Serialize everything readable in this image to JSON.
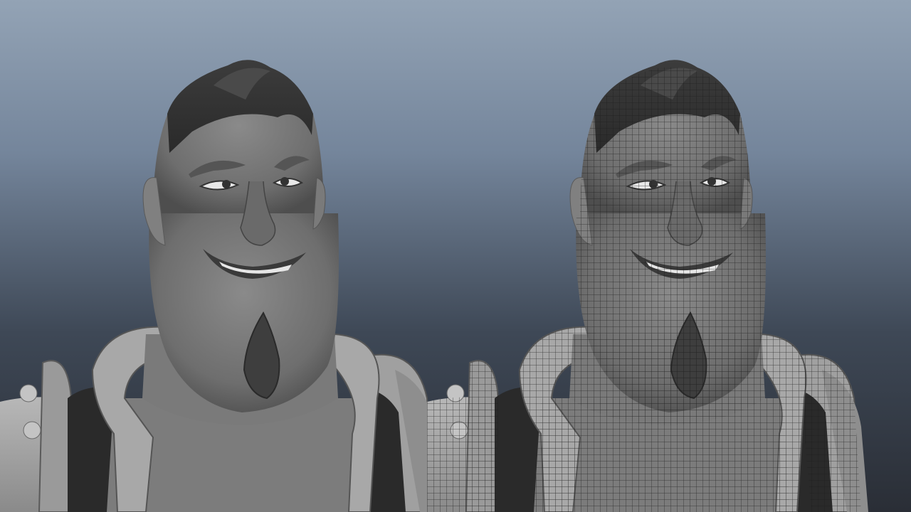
{
  "scene": {
    "background_top": "#93a3b5",
    "background_bottom": "#2a2e36",
    "panels": [
      {
        "id": "shaded",
        "display_mode": "smooth-shaded",
        "subject": "cartoon-character-bust"
      },
      {
        "id": "wireframe",
        "display_mode": "wireframe-on-shaded",
        "subject": "cartoon-character-bust"
      }
    ]
  }
}
